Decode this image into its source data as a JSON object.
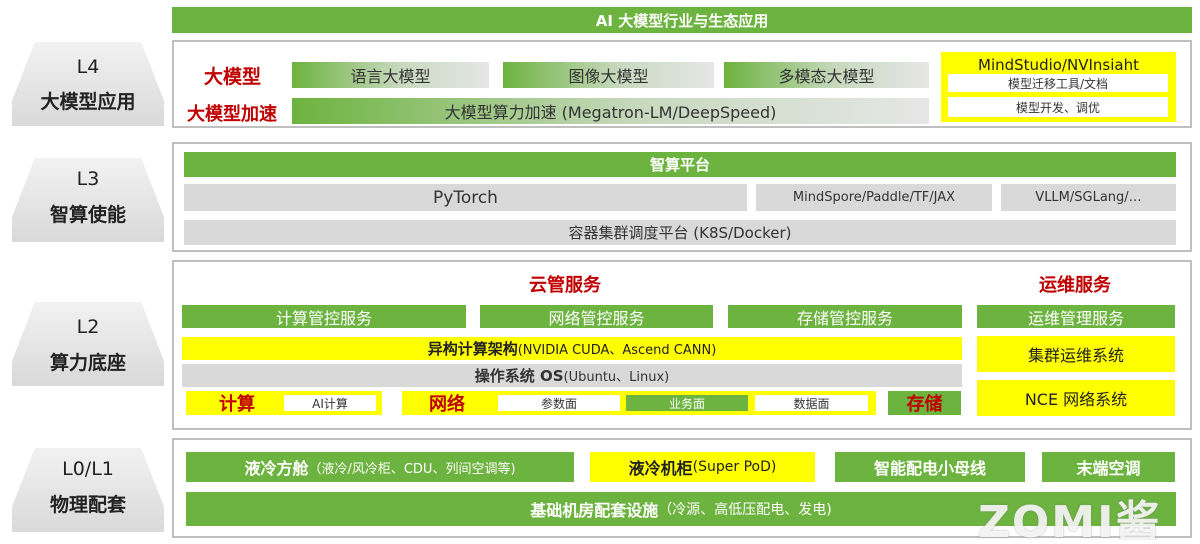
{
  "top_banner": "AI 大模型行业与生态应用",
  "layers": {
    "l4": {
      "id": "L4",
      "name": "大模型应用"
    },
    "l3": {
      "id": "L3",
      "name": "智算使能"
    },
    "l2": {
      "id": "L2",
      "name": "算力底座"
    },
    "l01": {
      "id": "L0/L1",
      "name": "物理配套"
    }
  },
  "l4": {
    "row1_label": "大模型",
    "row1_items": [
      "语言大模型",
      "图像大模型",
      "多模态大模型"
    ],
    "row2_label": "大模型加速",
    "row2_item": "大模型算力加速 (Megatron-LM/DeepSpeed)",
    "tools_title": "MindStudio/NVInsiaht",
    "tools_items": [
      "模型迁移工具/文档",
      "模型开发、调优"
    ]
  },
  "l3": {
    "platform": "智算平台",
    "frameworks": [
      "PyTorch",
      "MindSpore/Paddle/TF/JAX",
      "VLLM/SGLang/…"
    ],
    "scheduler": "容器集群调度平台 (K8S/Docker)"
  },
  "l2": {
    "cloud_title": "云管服务",
    "ops_title": "运维服务",
    "cloud_services": [
      "计算管控服务",
      "网络管控服务",
      "存储管控服务"
    ],
    "ops_service": "运维管理服务",
    "hetero_bold": "异构计算架构",
    "hetero_rest": " (NVIDIA CUDA、Ascend CANN)",
    "cluster_ops": "集群运维系统",
    "os_bold": "操作系统 OS",
    "os_rest": " (Ubuntu、Linux)",
    "nce": "NCE 网络系统",
    "compute_label": "计算",
    "compute_item": "AI计算",
    "network_label": "网络",
    "network_items": [
      "参数面",
      "业务面",
      "数据面"
    ],
    "storage_label": "存储"
  },
  "l01": {
    "liquid_bold": "液冷方舱",
    "liquid_rest": "（液冷/风冷柜、CDU、列间空调等)",
    "cabinet_bold": "液冷机柜",
    "cabinet_rest": " (Super PoD)",
    "busbar": "智能配电小母线",
    "ac": "末端空调",
    "base_bold": "基础机房配套设施",
    "base_rest": "（冷源、高低压配电、发电)"
  },
  "watermark": "ZOMI酱",
  "colors": {
    "green": "#6db33f",
    "yellow": "#ffff00",
    "gray": "#d9d9d9",
    "red": "#c00000"
  }
}
